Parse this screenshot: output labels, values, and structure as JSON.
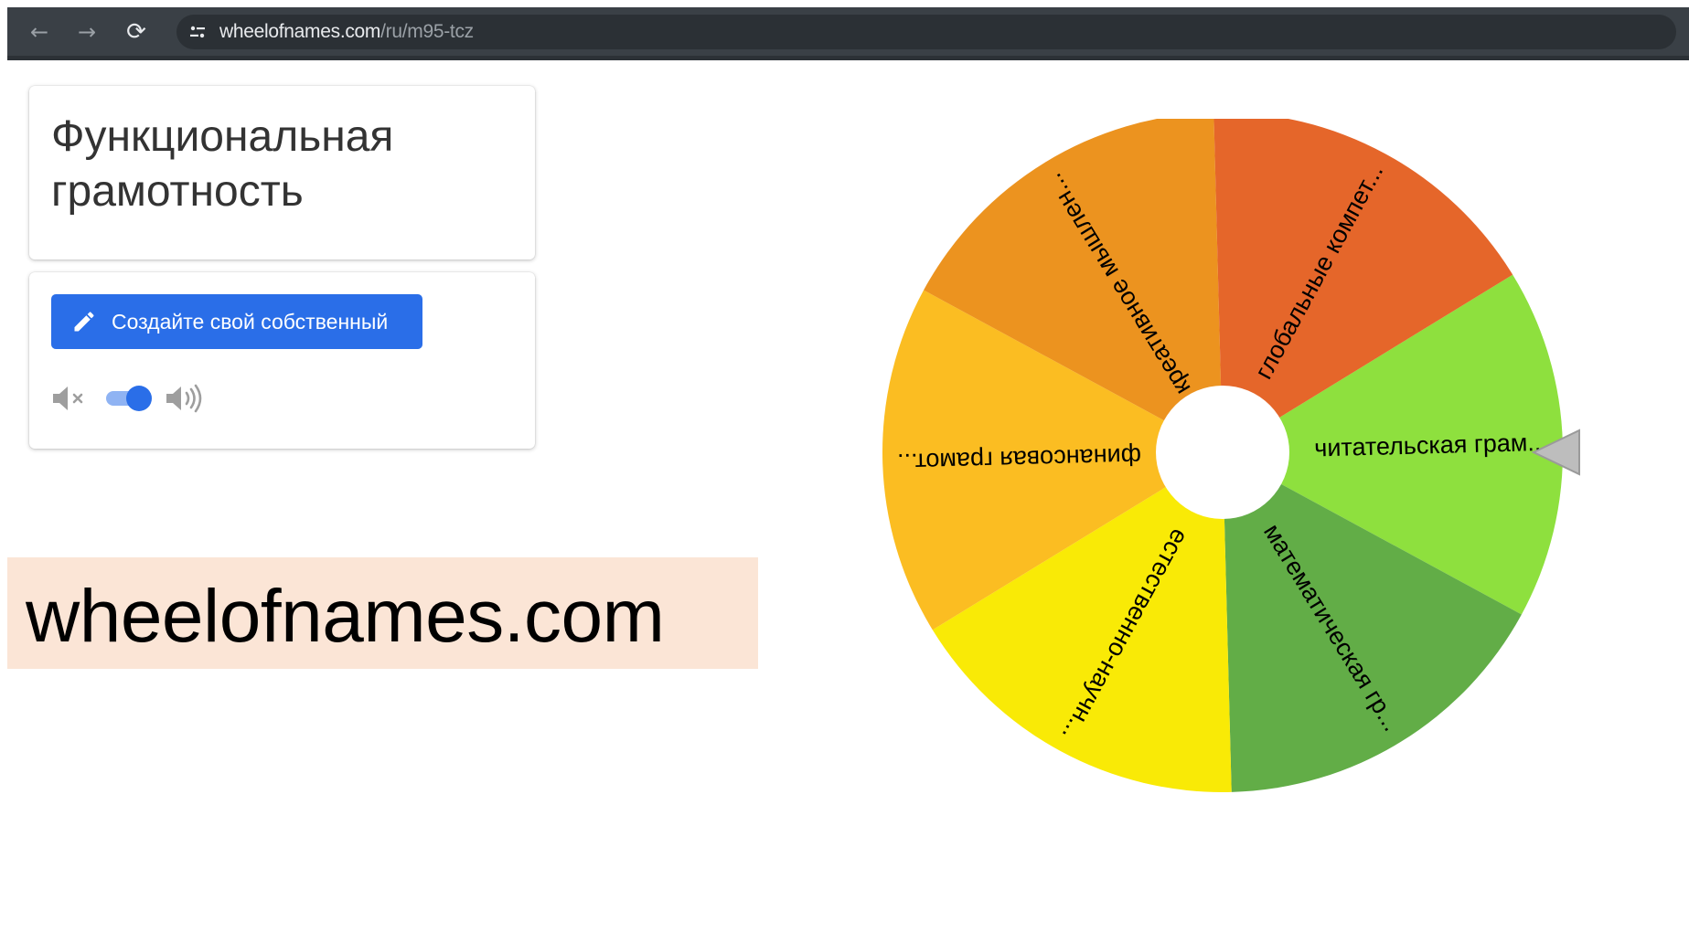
{
  "browser": {
    "back_glyph": "←",
    "forward_glyph": "→",
    "reload_glyph": "⟳",
    "url_host": "wheelofnames.com",
    "url_path": "/ru/m95-tcz"
  },
  "title_card": {
    "title": "Функциональная грамотность"
  },
  "controls": {
    "create_button_label": "Создайте свой собственный",
    "sound_enabled": true
  },
  "caption": {
    "text": "wheelofnames.com"
  },
  "wheel": {
    "segments": [
      {
        "label": "читательская грам...",
        "color": "#8ee03e"
      },
      {
        "label": "математическая гр...",
        "color": "#62ad47"
      },
      {
        "label": "естественно-научн...",
        "color": "#f9ea06"
      },
      {
        "label": "финансовая грамот...",
        "color": "#fbbd22"
      },
      {
        "label": "креативное мышлен...",
        "color": "#ec931f"
      },
      {
        "label": "глобальные компет...",
        "color": "#e5662a"
      }
    ],
    "center_color": "#ffffff",
    "pointer_color": "#bdbdbd"
  }
}
